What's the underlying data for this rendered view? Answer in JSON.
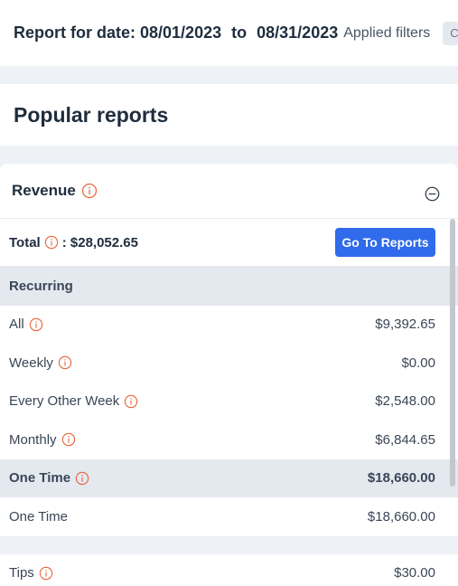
{
  "header": {
    "report_prefix": "Report for date:",
    "date_from": "08/01/2023",
    "to_word": "to",
    "date_to": "08/31/2023",
    "applied_filters": "Applied filters",
    "filter_chip": "C"
  },
  "popular": {
    "title": "Popular reports"
  },
  "revenue": {
    "title": "Revenue",
    "total_label": "Total",
    "total_value": ": $28,052.65",
    "go_button": "Go To Reports",
    "recurring_section": "Recurring",
    "rows": {
      "all": {
        "label": "All",
        "value": "$9,392.65"
      },
      "weekly": {
        "label": "Weekly",
        "value": "$0.00"
      },
      "every_other_week": {
        "label": "Every Other Week",
        "value": "$2,548.00"
      },
      "monthly": {
        "label": "Monthly",
        "value": "$6,844.65"
      },
      "one_time_section": {
        "label": "One Time",
        "value": "$18,660.00"
      },
      "one_time": {
        "label": "One Time",
        "value": "$18,660.00"
      },
      "tips": {
        "label": "Tips",
        "value": "$30.00"
      }
    }
  },
  "colors": {
    "accent": "#2f6bea",
    "info_icon": "#e8663a",
    "section_bg": "#e4e9f0",
    "page_bg": "#eef1f5"
  },
  "icons": {
    "info": "info-circle-icon",
    "collapse": "minus-circle-icon"
  }
}
